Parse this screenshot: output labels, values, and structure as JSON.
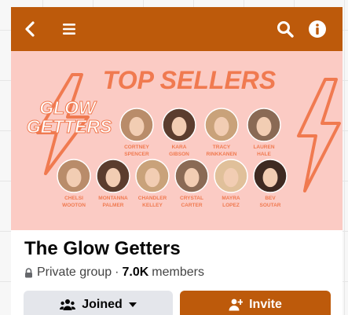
{
  "nav": {
    "back_icon": "chevron-left-icon",
    "menu_icon": "hamburger-menu-icon",
    "search_icon": "search-icon",
    "info_icon": "info-icon",
    "bar_color": "#bd5a0b"
  },
  "banner": {
    "logo_line1": "GLOW",
    "logo_line2": "GETTERS",
    "heading": "TOP SELLERS",
    "background_color": "#fbcbc4",
    "accent_color": "#f07a50",
    "sellers_row1": [
      {
        "first": "CORTNEY",
        "last": "SPENCER"
      },
      {
        "first": "KARA",
        "last": "GIBSON"
      },
      {
        "first": "TRACY",
        "last": "RINKKANEN"
      },
      {
        "first": "LAUREN",
        "last": "HALE"
      }
    ],
    "sellers_row2": [
      {
        "first": "CHELSI",
        "last": "WOOTON"
      },
      {
        "first": "MONTANNA",
        "last": "PALMER"
      },
      {
        "first": "CHANDLER",
        "last": "KELLEY"
      },
      {
        "first": "CRYSTAL",
        "last": "CARTER"
      },
      {
        "first": "MAYRA",
        "last": "LOPEZ"
      },
      {
        "first": "BEV",
        "last": "SOUTAR"
      }
    ]
  },
  "group": {
    "name": "The Glow Getters",
    "privacy": "Private group",
    "separator": "·",
    "member_count": "7.0K",
    "member_label": "members"
  },
  "actions": {
    "joined_label": "Joined",
    "invite_label": "Invite"
  }
}
